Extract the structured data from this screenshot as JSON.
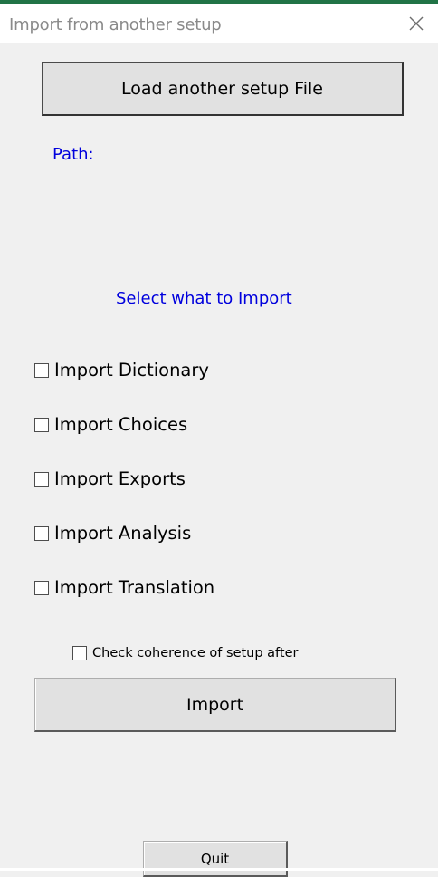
{
  "window": {
    "title": "Import from another setup",
    "close_icon": "close-icon",
    "accent_color": "#217346"
  },
  "buttons": {
    "load": "Load another setup File",
    "import": "Import",
    "quit": "Quit"
  },
  "path": {
    "label": "Path:"
  },
  "section": {
    "label": "Select what to Import"
  },
  "options": [
    {
      "label": "Import Dictionary",
      "checked": false
    },
    {
      "label": "Import Choices",
      "checked": false
    },
    {
      "label": "Import Exports",
      "checked": false
    },
    {
      "label": "Import Analysis",
      "checked": false
    },
    {
      "label": "Import Translation",
      "checked": false
    }
  ],
  "coherence": {
    "label": "Check coherence of setup after import",
    "checked": false
  },
  "colors": {
    "label_blue": "#0000dd",
    "background": "#f0f0f0"
  }
}
